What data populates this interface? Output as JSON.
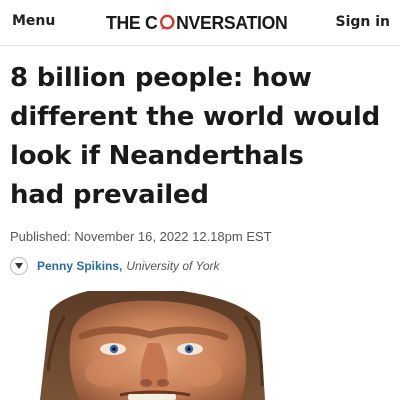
{
  "header": {
    "menu_label": "Menu",
    "logo_text_before": "THE C",
    "logo_text_after": "NVERSATION",
    "signin_label": "Sign in",
    "brand_color": "#d8352a"
  },
  "article": {
    "headline_lines": [
      "8 billion people: how",
      "different the world would",
      "look if Neanderthals",
      "had prevailed"
    ],
    "published": "Published: November 16, 2022 12.18pm EST",
    "author_name": "Penny Spikins",
    "author_separator": ",",
    "author_affiliation": "University of York"
  },
  "icons": {
    "menu": "menu-label",
    "author_toggle": "chevron-down-icon",
    "logo_mark": "speech-bubble-o-icon"
  }
}
